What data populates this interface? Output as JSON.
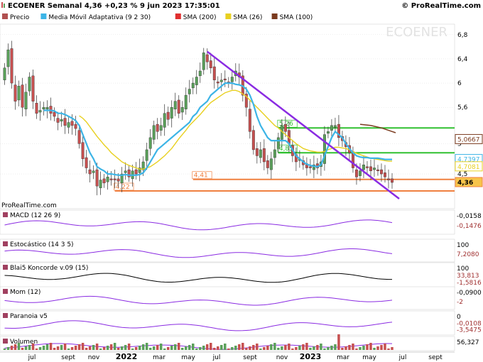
{
  "header": {
    "title": "ECOENER Semanal 4,36 +0,23 % 9 jun 2023 17:35:01",
    "brand": "© ProRealTime.com",
    "watermark": "ECOENER",
    "source": "ProRealTime.com"
  },
  "legend": [
    {
      "label": "Precio",
      "color": "#b05050"
    },
    {
      "label": "Media Móvil Adaptativa (9 2 30)",
      "color": "#3cb4e6"
    },
    {
      "label": "SMA (200)",
      "color": "#e03030"
    },
    {
      "label": "SMA (26)",
      "color": "#e8d020"
    },
    {
      "label": "SMA (100)",
      "color": "#7a3a1e"
    }
  ],
  "colors": {
    "up": "#5aa05a",
    "down": "#c65050",
    "trendline": "#8a2be2",
    "support": "#f08040",
    "resistance": "#30c030",
    "grid": "#dddddd"
  },
  "chart_data": {
    "type": "line",
    "title": "ECOENER Semanal",
    "ylim": [
      3.95,
      6.95
    ],
    "y_ticks": [
      "6,8",
      "6,4",
      "6",
      "5,6",
      "5",
      "4,5"
    ],
    "x_ticks": [
      "jul",
      "sept",
      "nov",
      "2022",
      "mar",
      "may",
      "jul",
      "sept",
      "nov",
      "2023",
      "mar",
      "may",
      "jul",
      "sept"
    ],
    "close": [
      6.25,
      6.55,
      6.0,
      5.7,
      5.95,
      5.6,
      5.85,
      6.1,
      5.7,
      5.5,
      5.55,
      5.6,
      5.6,
      5.5,
      5.45,
      5.35,
      5.4,
      5.3,
      5.35,
      5.3,
      5.25,
      5.0,
      4.75,
      4.6,
      4.5,
      4.55,
      4.3,
      4.4,
      4.35,
      4.45,
      4.4,
      4.4,
      4.38,
      4.5,
      4.55,
      4.45,
      4.55,
      4.5,
      4.6,
      4.7,
      4.9,
      5.1,
      5.3,
      5.2,
      5.3,
      5.5,
      5.4,
      5.6,
      5.7,
      5.5,
      5.6,
      5.8,
      5.9,
      6.0,
      6.1,
      6.2,
      6.5,
      6.35,
      6.25,
      6.05,
      6.0,
      6.05,
      6.05,
      6.0,
      6.1,
      6.2,
      6.1,
      5.8,
      5.6,
      5.2,
      4.9,
      4.8,
      4.9,
      4.7,
      4.6,
      4.75,
      4.9,
      5.1,
      5.3,
      5.2,
      5.0,
      4.8,
      4.7,
      4.75,
      4.65,
      4.6,
      4.6,
      4.65,
      4.6,
      4.7,
      5.15,
      5.2,
      5.3,
      5.3,
      5.1,
      5.05,
      4.95,
      4.85,
      4.6,
      4.45,
      4.55,
      4.65,
      4.6,
      4.55,
      4.6,
      4.55,
      4.5,
      4.45,
      4.4,
      4.36
    ],
    "ama": [
      null,
      null,
      null,
      null,
      null,
      null,
      null,
      null,
      null,
      null,
      null,
      5.55,
      5.55,
      5.55,
      5.54,
      5.5,
      5.5,
      5.48,
      5.45,
      5.42,
      5.38,
      5.3,
      5.15,
      5.0,
      4.85,
      4.75,
      4.62,
      4.58,
      4.55,
      4.5,
      4.5,
      4.49,
      4.48,
      4.48,
      4.49,
      4.48,
      4.48,
      4.48,
      4.49,
      4.52,
      4.6,
      4.7,
      4.8,
      4.9,
      4.95,
      5.0,
      5.05,
      5.1,
      5.15,
      5.2,
      5.25,
      5.3,
      5.35,
      5.45,
      5.5,
      5.6,
      5.65,
      5.7,
      5.8,
      5.85,
      5.9,
      5.95,
      6.0,
      6.0,
      6.0,
      5.98,
      5.97,
      5.95,
      5.9,
      5.8,
      5.65,
      5.45,
      5.3,
      5.2,
      5.1,
      5.05,
      5.05,
      5.05,
      5.05,
      5.05,
      5.0,
      4.9,
      4.8,
      4.75,
      4.7,
      4.66,
      4.64,
      4.63,
      4.62,
      4.65,
      4.8,
      4.95,
      5.1,
      5.2,
      5.15,
      5.1,
      5.0,
      4.92,
      4.85,
      4.8,
      4.78,
      4.77,
      4.77,
      4.76,
      4.76,
      4.76,
      4.75,
      4.74,
      4.74,
      4.74
    ],
    "sma26": [
      null,
      null,
      null,
      null,
      null,
      null,
      null,
      null,
      null,
      null,
      null,
      null,
      null,
      null,
      null,
      null,
      null,
      null,
      null,
      null,
      null,
      5.46,
      5.42,
      5.36,
      5.28,
      5.2,
      5.12,
      5.05,
      4.98,
      4.92,
      4.85,
      4.8,
      4.75,
      4.7,
      4.67,
      4.64,
      4.62,
      4.6,
      4.58,
      4.58,
      4.6,
      4.62,
      4.66,
      4.7,
      4.75,
      4.8,
      4.86,
      4.92,
      5.0,
      5.08,
      5.15,
      5.22,
      5.3,
      5.36,
      5.42,
      5.48,
      5.55,
      5.62,
      5.68,
      5.72,
      5.76,
      5.8,
      5.84,
      5.86,
      5.88,
      5.88,
      5.86,
      5.82,
      5.78,
      5.72,
      5.66,
      5.6,
      5.54,
      5.48,
      5.42,
      5.36,
      5.3,
      5.26,
      5.2,
      5.15,
      5.1,
      5.05,
      5.0,
      4.96,
      4.92,
      4.9,
      4.88,
      4.87,
      4.86,
      4.86,
      4.87,
      4.9,
      4.92,
      4.94,
      4.94,
      4.93,
      4.92,
      4.9,
      4.87,
      4.84,
      4.82,
      4.8,
      4.78,
      4.76,
      4.75,
      4.74,
      4.73,
      4.72,
      4.71,
      4.71
    ],
    "sma100": [
      [
        100,
        5.32
      ],
      [
        103,
        5.3
      ],
      [
        106,
        5.26
      ],
      [
        109,
        5.2
      ],
      [
        110,
        5.18
      ]
    ],
    "trendline": [
      [
        57,
        6.52
      ],
      [
        111,
        4.09
      ]
    ],
    "support_lines": [
      {
        "value": 4.41,
        "label": "4,41",
        "from": 53
      },
      {
        "value": 4.22,
        "label": "4,22",
        "from": 31
      }
    ],
    "resistance_lines": [
      {
        "value": 5.26,
        "label": "5,26",
        "from": 77
      },
      {
        "value": 4.85,
        "label": "4,85",
        "from": 77
      }
    ],
    "price_labels": [
      {
        "text": "5,0667",
        "color": "#7a3a1e",
        "value": 5.07
      },
      {
        "text": "4,7397",
        "color": "#3cb4e6",
        "value": 4.74
      },
      {
        "text": "4,7081",
        "color": "#e8d020",
        "value": 4.62
      },
      {
        "text": "4,36",
        "color": "#f08040",
        "value": 4.36
      }
    ],
    "indicators": [
      {
        "name": "MACD (12 26 9)",
        "labels": [
          "-0,0158",
          "-0,1476"
        ]
      },
      {
        "name": "Estocástico (14 3 5)",
        "labels": [
          "100",
          "7,2080"
        ]
      },
      {
        "name": "Blai5 Koncorde v.09 (15)",
        "labels": [
          "100",
          "33,813",
          "-1,5816"
        ]
      },
      {
        "name": "Mom (12)",
        "labels": [
          "-0,0900",
          "-2"
        ]
      },
      {
        "name": "Paranoia v5",
        "labels": [
          "0",
          "-0,0108",
          "-3,5475"
        ]
      },
      {
        "name": "Volumen",
        "labels": [
          "56,327"
        ]
      }
    ]
  }
}
